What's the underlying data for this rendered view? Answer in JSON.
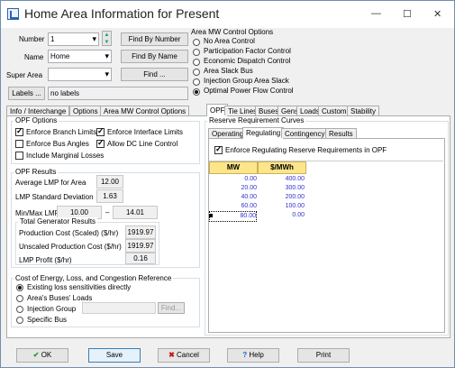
{
  "window": {
    "title": "Home Area Information for Present",
    "minimize": "—",
    "maximize": "☐",
    "close": "✕"
  },
  "form": {
    "number_label": "Number",
    "number_value": "1",
    "find_by_number": "Find By Number",
    "name_label": "Name",
    "name_value": "Home",
    "find_by_name": "Find By Name",
    "super_area_label": "Super Area",
    "super_area_value": "",
    "find": "Find ...",
    "labels_button": "Labels ...",
    "labels_value": "no labels"
  },
  "mw_control": {
    "title": "Area MW Control Options",
    "options": [
      "No Area Control",
      "Participation Factor Control",
      "Economic Dispatch Control",
      "Area Slack Bus",
      "Injection Group Area Slack",
      "Optimal Power Flow Control"
    ],
    "selected": 5
  },
  "tabs": [
    "Info / Interchange",
    "Options",
    "Area MW Control Options",
    "OPF",
    "Tie Lines",
    "Buses",
    "Gens",
    "Loads",
    "Custom",
    "Stability"
  ],
  "opf_options": {
    "title": "OPF Options",
    "items": [
      {
        "label": "Enforce Branch Limits",
        "checked": true
      },
      {
        "label": "Enforce Interface Limits",
        "checked": true
      },
      {
        "label": "Enforce Bus Angles",
        "checked": false
      },
      {
        "label": "Allow DC Line Control",
        "checked": true
      },
      {
        "label": "Include Marginal Losses",
        "checked": false
      }
    ]
  },
  "opf_results": {
    "title": "OPF Results",
    "avg_lmp_label": "Average LMP for Area",
    "avg_lmp": "12.00",
    "lmp_std_label": "LMP Standard Deviation",
    "lmp_std": "1.63",
    "minmax_label": "Min/Max LMP",
    "min": "10.00",
    "dash": "–",
    "max": "14.01"
  },
  "gen_results": {
    "title": "Total Generator Results",
    "scaled_label": "Production Cost (Scaled) ($/hr)",
    "scaled": "1919.97",
    "unscaled_label": "Unscaled Production Cost ($/hr)",
    "unscaled": "1919.97",
    "profit_label": "LMP Profit ($/hr)",
    "profit": "0.16"
  },
  "cost_ref": {
    "title": "Cost of Energy, Loss, and Congestion Reference",
    "options": [
      "Existing loss sensitivities directly",
      "Area's Buses' Loads",
      "Injection Group",
      "Specific Bus"
    ],
    "selected": 0,
    "find": "Find..."
  },
  "reserve": {
    "title": "Reserve Requirement Curves",
    "tabs": [
      "Operating",
      "Regulating",
      "Contingency",
      "Results"
    ],
    "enforce_label": "Enforce Regulating Reserve Requirements in OPF",
    "col_mw": "MW",
    "col_price": "$/MWh",
    "rows": [
      [
        "0.00",
        "400.00"
      ],
      [
        "20.00",
        "300.00"
      ],
      [
        "40.00",
        "200.00"
      ],
      [
        "60.00",
        "100.00"
      ],
      [
        "80.00",
        "0.00"
      ]
    ]
  },
  "footer": {
    "ok": "OK",
    "save": "Save",
    "cancel": "Cancel",
    "help": "Help",
    "print": "Print"
  }
}
